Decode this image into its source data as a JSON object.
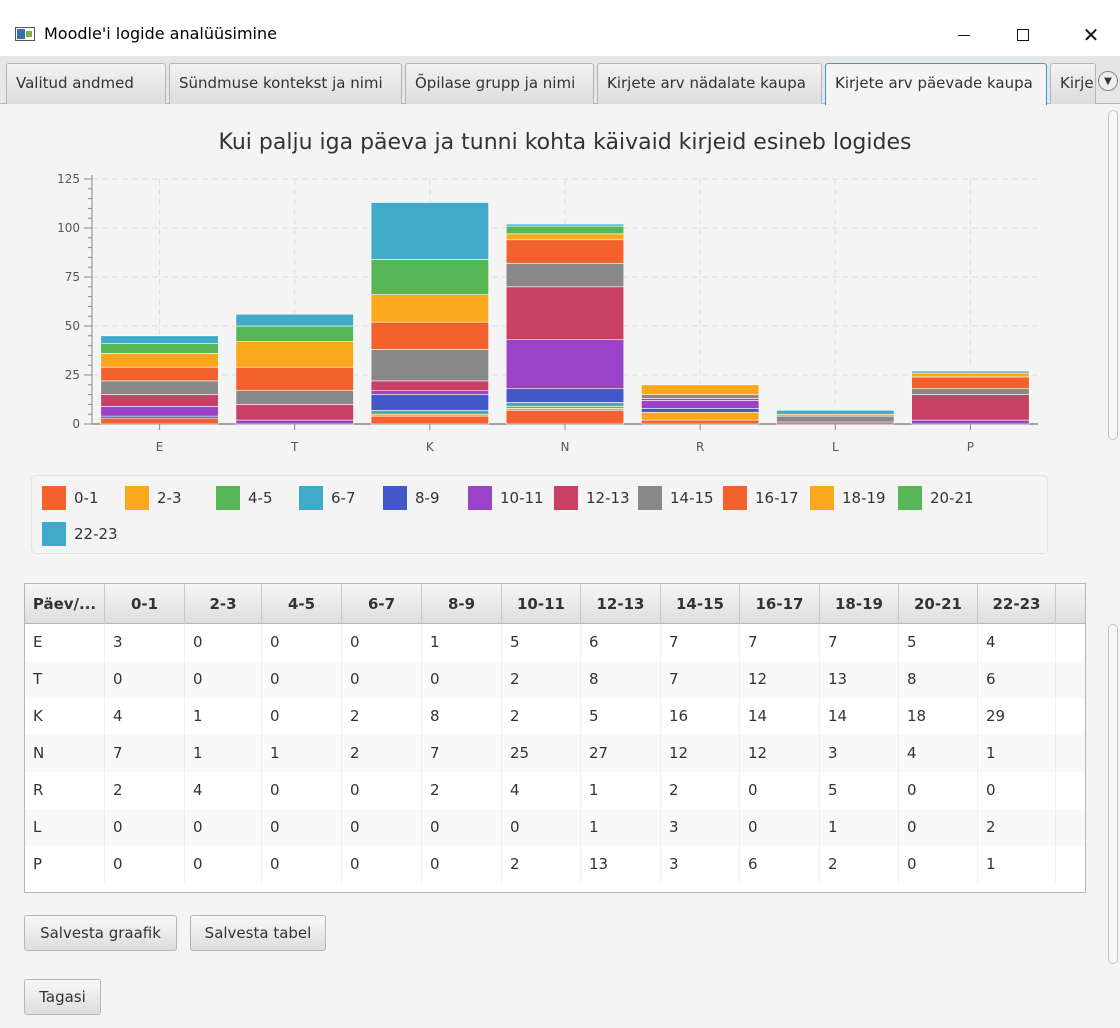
{
  "window": {
    "title": "Moodle'i logide analüüsimine"
  },
  "tabs": [
    {
      "label": "Valitud andmed"
    },
    {
      "label": "Sündmuse kontekst ja nimi"
    },
    {
      "label": "Õpilase grupp ja nimi"
    },
    {
      "label": "Kirjete arv nädalate kaupa"
    },
    {
      "label": "Kirjete arv päevade kaupa",
      "selected": true
    },
    {
      "label": "Kirje"
    }
  ],
  "chart_data": {
    "type": "bar",
    "stacked": true,
    "title": "Kui palju iga päeva ja tunni kohta käivaid kirjeid esineb logides",
    "xlabel": "",
    "ylabel": "",
    "categories": [
      "E",
      "T",
      "K",
      "N",
      "R",
      "L",
      "P"
    ],
    "y_ticks": [
      "0",
      "25",
      "50",
      "75",
      "100",
      "125"
    ],
    "ylim": [
      0,
      125
    ],
    "grid": true,
    "legend_position": "bottom",
    "series": [
      {
        "name": "0-1",
        "color": "#f3622d",
        "values": [
          3,
          0,
          4,
          7,
          2,
          0,
          0
        ]
      },
      {
        "name": "2-3",
        "color": "#fba71b",
        "values": [
          0,
          0,
          1,
          1,
          4,
          0,
          0
        ]
      },
      {
        "name": "4-5",
        "color": "#57b757",
        "values": [
          0,
          0,
          0,
          1,
          0,
          0,
          0
        ]
      },
      {
        "name": "6-7",
        "color": "#41a9c9",
        "values": [
          0,
          0,
          2,
          2,
          0,
          0,
          0
        ]
      },
      {
        "name": "8-9",
        "color": "#4258c9",
        "values": [
          1,
          0,
          8,
          7,
          2,
          0,
          0
        ]
      },
      {
        "name": "10-11",
        "color": "#9a42c8",
        "values": [
          5,
          2,
          2,
          25,
          4,
          0,
          2
        ]
      },
      {
        "name": "12-13",
        "color": "#c84164",
        "values": [
          6,
          8,
          5,
          27,
          1,
          1,
          13
        ]
      },
      {
        "name": "14-15",
        "color": "#888888",
        "values": [
          7,
          7,
          16,
          12,
          2,
          3,
          3
        ]
      },
      {
        "name": "16-17",
        "color": "#f3622d",
        "values": [
          7,
          12,
          14,
          12,
          0,
          0,
          6
        ]
      },
      {
        "name": "18-19",
        "color": "#fba71b",
        "values": [
          7,
          13,
          14,
          3,
          5,
          1,
          2
        ]
      },
      {
        "name": "20-21",
        "color": "#57b757",
        "values": [
          5,
          8,
          18,
          4,
          0,
          0,
          0
        ]
      },
      {
        "name": "22-23",
        "color": "#41a9c9",
        "values": [
          4,
          6,
          29,
          1,
          0,
          2,
          1
        ]
      }
    ]
  },
  "table": {
    "columns": [
      "Päev/...",
      "0-1",
      "2-3",
      "4-5",
      "6-7",
      "8-9",
      "10-11",
      "12-13",
      "14-15",
      "16-17",
      "18-19",
      "20-21",
      "22-23"
    ],
    "rows": [
      [
        "E",
        "3",
        "0",
        "0",
        "0",
        "1",
        "5",
        "6",
        "7",
        "7",
        "7",
        "5",
        "4"
      ],
      [
        "T",
        "0",
        "0",
        "0",
        "0",
        "0",
        "2",
        "8",
        "7",
        "12",
        "13",
        "8",
        "6"
      ],
      [
        "K",
        "4",
        "1",
        "0",
        "2",
        "8",
        "2",
        "5",
        "16",
        "14",
        "14",
        "18",
        "29"
      ],
      [
        "N",
        "7",
        "1",
        "1",
        "2",
        "7",
        "25",
        "27",
        "12",
        "12",
        "3",
        "4",
        "1"
      ],
      [
        "R",
        "2",
        "4",
        "0",
        "0",
        "2",
        "4",
        "1",
        "2",
        "0",
        "5",
        "0",
        "0"
      ],
      [
        "L",
        "0",
        "0",
        "0",
        "0",
        "0",
        "0",
        "1",
        "3",
        "0",
        "1",
        "0",
        "2"
      ],
      [
        "P",
        "0",
        "0",
        "0",
        "0",
        "0",
        "2",
        "13",
        "3",
        "6",
        "2",
        "0",
        "1"
      ]
    ]
  },
  "buttons": {
    "save_chart": "Salvesta graafik",
    "save_table": "Salvesta tabel",
    "back": "Tagasi"
  }
}
